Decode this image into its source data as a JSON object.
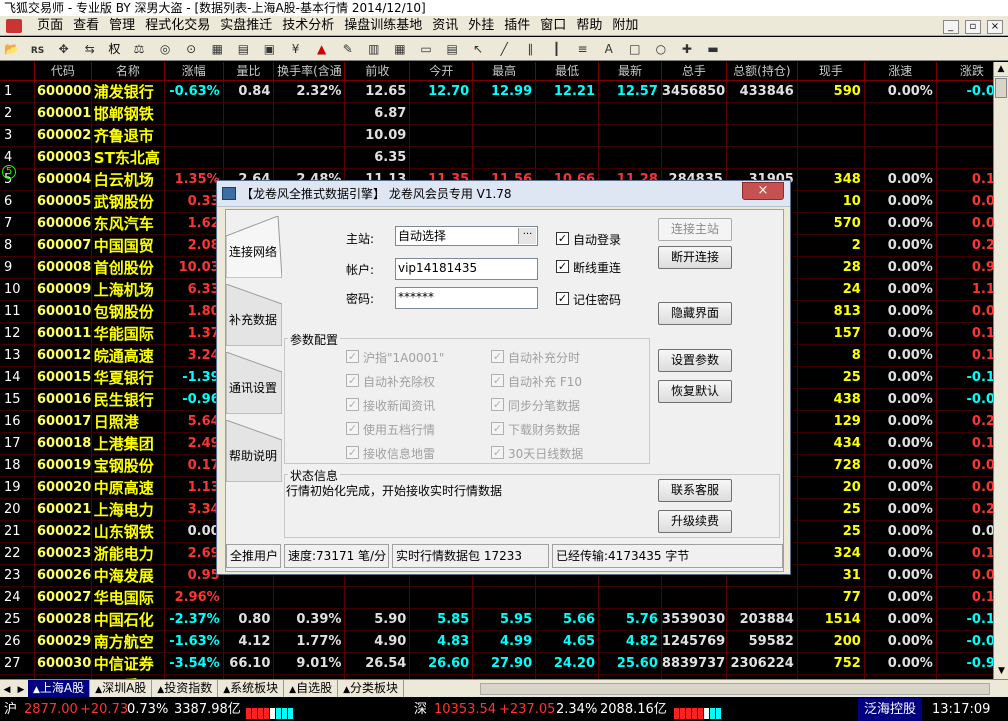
{
  "window": {
    "title": "飞狐交易师 - 专业版 BY 深男大盗 - [数据列表-上海A股-基本行情 2014/12/10]",
    "controls": [
      "_",
      "▫",
      "×"
    ]
  },
  "menu": [
    "页面",
    "查看",
    "管理",
    "程式化交易",
    "实盘推迁",
    "技术分析",
    "操盘训练基地",
    "资讯",
    "外挂",
    "插件",
    "窗口",
    "帮助",
    "附加"
  ],
  "toolbar": {
    "rights_label": "权",
    "icons": [
      "folder-open-icon",
      "rs-icon",
      "move-icon",
      "swap-icon",
      "weight-icon",
      "glasses-icon",
      "binoculars-icon",
      "calculator-icon",
      "chart-icon",
      "book-icon",
      "image-icon",
      "money-icon",
      "alert-icon",
      "pen-icon",
      "bars-icon",
      "grid-icon",
      "window-icon",
      "table-icon",
      "cursor-icon",
      "line-icon",
      "parallel-icon",
      "vline-icon",
      "fib-icon",
      "text-icon",
      "rect-icon",
      "ellipse-icon",
      "cross-icon",
      "save-icon"
    ]
  },
  "grid": {
    "columns": [
      "",
      "代码",
      "名称",
      "涨幅",
      "量比",
      "换手率(含通",
      "前收",
      "今开",
      "最高",
      "最低",
      "最新",
      "总手",
      "总额(持仓)",
      "现手",
      "涨速",
      "涨跌"
    ],
    "rows": [
      {
        "n": "1",
        "code": "600000",
        "name": "浦发银行",
        "chg": "-0.63%",
        "vr": "0.84",
        "to": "2.32%",
        "prev": "12.65",
        "open": "12.70",
        "high": "12.99",
        "low": "12.21",
        "last": "12.57",
        "vol": "3456850",
        "amt": "433846",
        "cur": "590",
        "spd": "0.00%",
        "diff": "-0.08",
        "dir": "down",
        "cells": [
          "down",
          "white",
          "white",
          "white",
          "up",
          "up",
          "down",
          "down",
          "white",
          "white",
          "down",
          "white",
          "down"
        ]
      },
      {
        "n": "2",
        "code": "600001",
        "name": "邯郸钢铁",
        "chg": "",
        "vr": "",
        "to": "",
        "prev": "6.87",
        "open": "",
        "high": "",
        "low": "",
        "last": "",
        "vol": "",
        "amt": "",
        "cur": "",
        "spd": "",
        "diff": "",
        "dir": "none"
      },
      {
        "n": "3",
        "code": "600002",
        "name": "齐鲁退市",
        "chg": "",
        "vr": "",
        "to": "",
        "prev": "10.09",
        "open": "",
        "high": "",
        "low": "",
        "last": "",
        "vol": "",
        "amt": "",
        "cur": "",
        "spd": "",
        "diff": "",
        "dir": "none"
      },
      {
        "n": "4",
        "code": "600003",
        "name": "ST东北高",
        "chg": "",
        "vr": "",
        "to": "",
        "prev": "6.35",
        "open": "",
        "high": "",
        "low": "",
        "last": "",
        "vol": "",
        "amt": "",
        "cur": "",
        "spd": "",
        "diff": "",
        "dir": "none"
      },
      {
        "n": "5",
        "code": "600004",
        "name": "白云机场",
        "chg": "1.35%",
        "vr": "2.64",
        "to": "2.48%",
        "prev": "11.13",
        "open": "11.35",
        "high": "11.56",
        "low": "10.66",
        "last": "11.28",
        "vol": "284835",
        "amt": "31905",
        "cur": "348",
        "spd": "0.00%",
        "diff": "0.15",
        "dir": "up"
      },
      {
        "n": "6",
        "code": "600005",
        "name": "武钢股份",
        "chg": "0.33",
        "vr": "",
        "to": "",
        "prev": "",
        "open": "",
        "high": "",
        "low": "",
        "last": "",
        "vol": "",
        "amt": "",
        "cur": "10",
        "spd": "0.00%",
        "diff": "0.01",
        "dir": "up"
      },
      {
        "n": "7",
        "code": "600006",
        "name": "东风汽车",
        "chg": "1.62",
        "vr": "",
        "to": "",
        "prev": "",
        "open": "",
        "high": "",
        "low": "",
        "last": "",
        "vol": "",
        "amt": "",
        "cur": "570",
        "spd": "0.00%",
        "diff": "0.09",
        "dir": "up"
      },
      {
        "n": "8",
        "code": "600007",
        "name": "中国国贸",
        "chg": "2.08",
        "vr": "",
        "to": "",
        "prev": "",
        "open": "",
        "high": "",
        "low": "",
        "last": "",
        "vol": "",
        "amt": "",
        "cur": "2",
        "spd": "0.00%",
        "diff": "0.29",
        "dir": "up"
      },
      {
        "n": "9",
        "code": "600008",
        "name": "首创股份",
        "chg": "10.03",
        "vr": "",
        "to": "",
        "prev": "",
        "open": "",
        "high": "",
        "low": "",
        "last": "",
        "vol": "",
        "amt": "",
        "cur": "28",
        "spd": "0.00%",
        "diff": "0.91",
        "dir": "up"
      },
      {
        "n": "10",
        "code": "600009",
        "name": "上海机场",
        "chg": "6.33",
        "vr": "",
        "to": "",
        "prev": "",
        "open": "",
        "high": "",
        "low": "",
        "last": "",
        "vol": "",
        "amt": "",
        "cur": "24",
        "spd": "0.00%",
        "diff": "1.16",
        "dir": "up"
      },
      {
        "n": "11",
        "code": "600010",
        "name": "包钢股份",
        "chg": "1.80",
        "vr": "",
        "to": "",
        "prev": "",
        "open": "",
        "high": "",
        "low": "",
        "last": "",
        "vol": "",
        "amt": "",
        "cur": "813",
        "spd": "0.00%",
        "diff": "0.09",
        "dir": "up"
      },
      {
        "n": "12",
        "code": "600011",
        "name": "华能国际",
        "chg": "1.37",
        "vr": "",
        "to": "",
        "prev": "",
        "open": "",
        "high": "",
        "low": "",
        "last": "",
        "vol": "",
        "amt": "",
        "cur": "157",
        "spd": "0.00%",
        "diff": "0.10",
        "dir": "up"
      },
      {
        "n": "13",
        "code": "600012",
        "name": "皖通高速",
        "chg": "3.24",
        "vr": "",
        "to": "",
        "prev": "",
        "open": "",
        "high": "",
        "low": "",
        "last": "",
        "vol": "",
        "amt": "",
        "cur": "8",
        "spd": "0.00%",
        "diff": "0.18",
        "dir": "up"
      },
      {
        "n": "14",
        "code": "600015",
        "name": "华夏银行",
        "chg": "-1.39",
        "vr": "",
        "to": "",
        "prev": "",
        "open": "",
        "high": "",
        "low": "",
        "last": "",
        "vol": "",
        "amt": "",
        "cur": "25",
        "spd": "0.00%",
        "diff": "-0.15",
        "dir": "down"
      },
      {
        "n": "15",
        "code": "600016",
        "name": "民生银行",
        "chg": "-0.96",
        "vr": "",
        "to": "",
        "prev": "",
        "open": "",
        "high": "",
        "low": "",
        "last": "",
        "vol": "",
        "amt": "",
        "cur": "438",
        "spd": "0.00%",
        "diff": "-0.08",
        "dir": "down"
      },
      {
        "n": "16",
        "code": "600017",
        "name": "日照港",
        "chg": "5.64",
        "vr": "",
        "to": "",
        "prev": "",
        "open": "",
        "high": "",
        "low": "",
        "last": "",
        "vol": "",
        "amt": "",
        "cur": "129",
        "spd": "0.00%",
        "diff": "0.25",
        "dir": "up"
      },
      {
        "n": "17",
        "code": "600018",
        "name": "上港集团",
        "chg": "2.49",
        "vr": "",
        "to": "",
        "prev": "",
        "open": "",
        "high": "",
        "low": "",
        "last": "",
        "vol": "",
        "amt": "",
        "cur": "434",
        "spd": "0.00%",
        "diff": "0.13",
        "dir": "up"
      },
      {
        "n": "18",
        "code": "600019",
        "name": "宝钢股份",
        "chg": "0.17",
        "vr": "",
        "to": "",
        "prev": "",
        "open": "",
        "high": "",
        "low": "",
        "last": "",
        "vol": "",
        "amt": "",
        "cur": "728",
        "spd": "0.00%",
        "diff": "0.01",
        "dir": "up"
      },
      {
        "n": "19",
        "code": "600020",
        "name": "中原高速",
        "chg": "1.13",
        "vr": "",
        "to": "",
        "prev": "",
        "open": "",
        "high": "",
        "low": "",
        "last": "",
        "vol": "",
        "amt": "",
        "cur": "20",
        "spd": "0.00%",
        "diff": "0.04",
        "dir": "up"
      },
      {
        "n": "20",
        "code": "600021",
        "name": "上海电力",
        "chg": "3.34",
        "vr": "",
        "to": "",
        "prev": "",
        "open": "",
        "high": "",
        "low": "",
        "last": "",
        "vol": "",
        "amt": "",
        "cur": "25",
        "spd": "0.00%",
        "diff": "0.25",
        "dir": "up"
      },
      {
        "n": "21",
        "code": "600022",
        "name": "山东钢铁",
        "chg": "0.00",
        "vr": "",
        "to": "",
        "prev": "",
        "open": "",
        "high": "",
        "low": "",
        "last": "",
        "vol": "",
        "amt": "",
        "cur": "25",
        "spd": "0.00%",
        "diff": "0.00",
        "dir": "none"
      },
      {
        "n": "22",
        "code": "600023",
        "name": "浙能电力",
        "chg": "2.69",
        "vr": "",
        "to": "",
        "prev": "",
        "open": "",
        "high": "",
        "low": "",
        "last": "",
        "vol": "",
        "amt": "",
        "cur": "324",
        "spd": "0.00%",
        "diff": "0.17",
        "dir": "up"
      },
      {
        "n": "23",
        "code": "600026",
        "name": "中海发展",
        "chg": "0.95",
        "vr": "",
        "to": "",
        "prev": "",
        "open": "",
        "high": "",
        "low": "",
        "last": "",
        "vol": "",
        "amt": "",
        "cur": "31",
        "spd": "0.00%",
        "diff": "0.06",
        "dir": "up"
      },
      {
        "n": "24",
        "code": "600027",
        "name": "华电国际",
        "chg": "2.96%",
        "vr": "",
        "to": "",
        "prev": "",
        "open": "",
        "high": "",
        "low": "",
        "last": "",
        "vol": "",
        "amt": "",
        "cur": "77",
        "spd": "0.00%",
        "diff": "0.16",
        "dir": "up"
      },
      {
        "n": "25",
        "code": "600028",
        "name": "中国石化",
        "chg": "-2.37%",
        "vr": "0.80",
        "to": "0.39%",
        "prev": "5.90",
        "open": "5.85",
        "high": "5.95",
        "low": "5.66",
        "last": "5.76",
        "vol": "3539030",
        "amt": "203884",
        "cur": "1514",
        "spd": "0.00%",
        "diff": "-0.14",
        "dir": "down"
      },
      {
        "n": "26",
        "code": "600029",
        "name": "南方航空",
        "chg": "-1.63%",
        "vr": "4.12",
        "to": "1.77%",
        "prev": "4.90",
        "open": "4.83",
        "high": "4.99",
        "low": "4.65",
        "last": "4.82",
        "vol": "1245769",
        "amt": "59582",
        "cur": "200",
        "spd": "0.00%",
        "diff": "-0.08",
        "dir": "down"
      },
      {
        "n": "27",
        "code": "600030",
        "name": "中信证券",
        "chg": "-3.54%",
        "vr": "66.10",
        "to": "9.01%",
        "prev": "26.54",
        "open": "26.60",
        "high": "27.90",
        "low": "24.20",
        "last": "25.60",
        "vol": "8839737",
        "amt": "2306224",
        "cur": "752",
        "spd": "0.00%",
        "diff": "-0.94",
        "dir": "down"
      },
      {
        "n": "28",
        "code": "600031",
        "name": "三一重工",
        "chg": "2.19%",
        "vr": "1.29",
        "to": "2.22%",
        "prev": "8.21",
        "open": "8.16",
        "high": "8.49",
        "low": "8.00",
        "last": "8.39",
        "vol": "1684544",
        "amt": "139598",
        "cur": "323",
        "spd": "0.00%",
        "diff": "0.18",
        "dir": "up"
      }
    ]
  },
  "tabs": [
    "上海A股",
    "深圳A股",
    "投资指数",
    "系统板块",
    "自选股",
    "分类板块"
  ],
  "status": {
    "sh_label": "沪",
    "sh_index": "2877.00",
    "sh_change": "+20.73",
    "sh_pct": "0.73%",
    "sh_amount": "3387.98亿",
    "sz_label": "深",
    "sz_index": "10353.54",
    "sz_change": "+237.05",
    "sz_pct": "2.34%",
    "sz_amount": "2088.16亿",
    "ticker": "泛海控股",
    "time": "13:17:09"
  },
  "dialog": {
    "title": "【龙卷风全推式数据引擎】 龙卷风会员专用 V1.78",
    "close": "×",
    "tabs": [
      "连接网络",
      "补充数据",
      "通讯设置",
      "帮助说明"
    ],
    "server_label": "主站:",
    "server_value": "自动选择",
    "browse": "···",
    "account_label": "帐户:",
    "account_value": "vip14181435",
    "password_label": "密码:",
    "password_value": "******",
    "auto_login": "自动登录",
    "reconnect": "断线重连",
    "remember_pw": "记住密码",
    "btn_connect": "连接主站",
    "btn_disconnect": "断开连接",
    "btn_hide": "隐藏界面",
    "param_title": "参数配置",
    "params_left": [
      "沪指\"1A0001\"",
      "自动补充除权",
      "接收新闻资讯",
      "使用五档行情",
      "接收信息地雷"
    ],
    "params_right": [
      "自动补充分时",
      "自动补充 F10",
      "同步分笔数据",
      "下载财务数据",
      "30天日线数据"
    ],
    "btn_set_params": "设置参数",
    "btn_restore": "恢复默认",
    "status_title": "状态信息",
    "status_text": "行情初始化完成，开始接收实时行情数据",
    "btn_support": "联系客服",
    "btn_renew": "升级续费",
    "sb_user": "全推用户",
    "sb_speed": "速度:73171 笔/分",
    "sb_packet": "实时行情数据包  17233",
    "sb_transferred": "已经传输:4173435 字节"
  },
  "colors": {
    "up": "#ff3333",
    "down": "#00ffff",
    "name": "#ffff00",
    "grid_line": "#7a0000"
  }
}
